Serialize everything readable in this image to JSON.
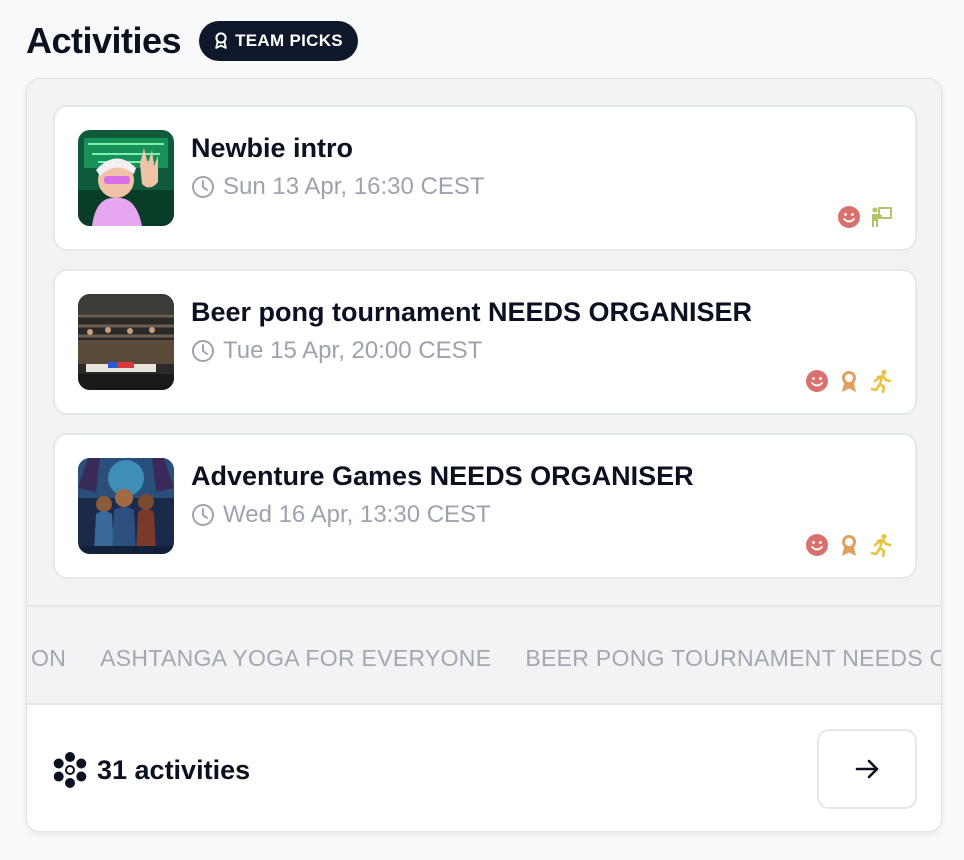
{
  "header": {
    "title": "Activities",
    "badge_label": "TEAM PICKS",
    "badge_icon": "award-ribbon-icon"
  },
  "activities": [
    {
      "title": "Newbie intro",
      "time": "Sun 13 Apr, 16:30 CEST",
      "thumbnail": "avatar-illustration",
      "tags": [
        "smile-icon",
        "teacher-board-icon"
      ]
    },
    {
      "title": "Beer pong tournament NEEDS ORGANISER",
      "time": "Tue 15 Apr, 20:00 CEST",
      "thumbnail": "event-hall-photo",
      "tags": [
        "smile-icon",
        "award-ribbon-icon",
        "running-icon"
      ]
    },
    {
      "title": "Adventure Games NEEDS ORGANISER",
      "time": "Wed 16 Apr, 13:30 CEST",
      "thumbnail": "adventure-group-illustration",
      "tags": [
        "smile-icon",
        "award-ribbon-icon",
        "running-icon"
      ]
    }
  ],
  "ticker": {
    "items": [
      "ON",
      "ASHTANGA YOGA FOR EVERYONE",
      "BEER PONG TOURNAMENT NEEDS O"
    ]
  },
  "footer": {
    "count_label": "31 activities",
    "count_icon": "asterisk-cluster-icon",
    "next_icon": "arrow-right-icon"
  },
  "colors": {
    "badge_bg": "#0f172a",
    "smile": "#d9716f",
    "award": "#e0a060",
    "teacher": "#b5c46a",
    "running": "#e8c240"
  }
}
